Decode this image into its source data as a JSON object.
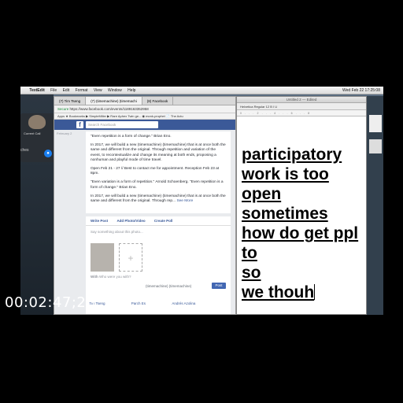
{
  "menubar": {
    "apple": "",
    "app": "TextEdit",
    "items": [
      "File",
      "Edit",
      "Format",
      "View",
      "Window",
      "Help"
    ],
    "clock": "Wed Feb 22  17:25:08"
  },
  "facetime": {
    "call_label": "Current Call",
    "side_text": "ches",
    "mute_icon": "microphone-icon",
    "end_icon": "end-call-icon"
  },
  "browser": {
    "tabs": [
      "(7) Tim Tseng",
      "(7) (timemachine) (timemachi",
      "(8) Facebook"
    ],
    "address_secure": "Secure",
    "address_url": "https://www.facebook.com/events/1189163352958",
    "bookmarks": "Apps  ★ Bookmarks  ▶ SimpleMiller  ▶ Rare Aphex Twin ge...  ◉ monk-prophet  📄 The Actu"
  },
  "facebook": {
    "logo": "f",
    "search_placeholder": "Search Facebook",
    "sidebar_date": "February 2",
    "card_paragraphs": [
      "\"Even repetition is a form of change.\" Brian Eno.",
      "In 2017, we will build a new (timemachine) (timemachine) that is at once both the same and different from the original. Through repetition and variation of the event, to recontextualize and change its meaning at both ends, proposing a nonhuman and playful mode of time travel.",
      "Open Feb 21 - 27 // Best to contact me for appointment. Reception Feb 23 at 8pm.",
      "\"Even variation is a form of repetition.\" Arnold Schoenberg. \"Even repetition is a form of change.\" Brian Eno.",
      "In 2017, we will build a new (timemachine) (timemachine) that is at once both the same and different from the original. Through rep..."
    ],
    "see_more": "See More",
    "post_tabs": [
      "Write Post",
      "Add Photo/Video",
      "Create Poll"
    ],
    "say_placeholder": "Say something about this photo...",
    "with_label": "With",
    "with_placeholder": "Who were you with?",
    "post_footer": "(timemachine) (timemachine)",
    "post_button": "Post",
    "names": [
      "Tim Tseng",
      "Parch Es",
      "Andrés Azolina"
    ]
  },
  "textedit": {
    "title": "Untitled 2 — Edited",
    "toolbar": "Helvetica  Regular  12  B I U",
    "ruler": "0 . . . 2 . . . 4 . . . 6 . . . 8",
    "lines": [
      "participatory",
      "work is too",
      "open",
      "sometimes",
      "how do get ppl",
      "to",
      "so",
      "we thouh"
    ]
  },
  "overlay": {
    "timecode": "00:02:47;28"
  }
}
